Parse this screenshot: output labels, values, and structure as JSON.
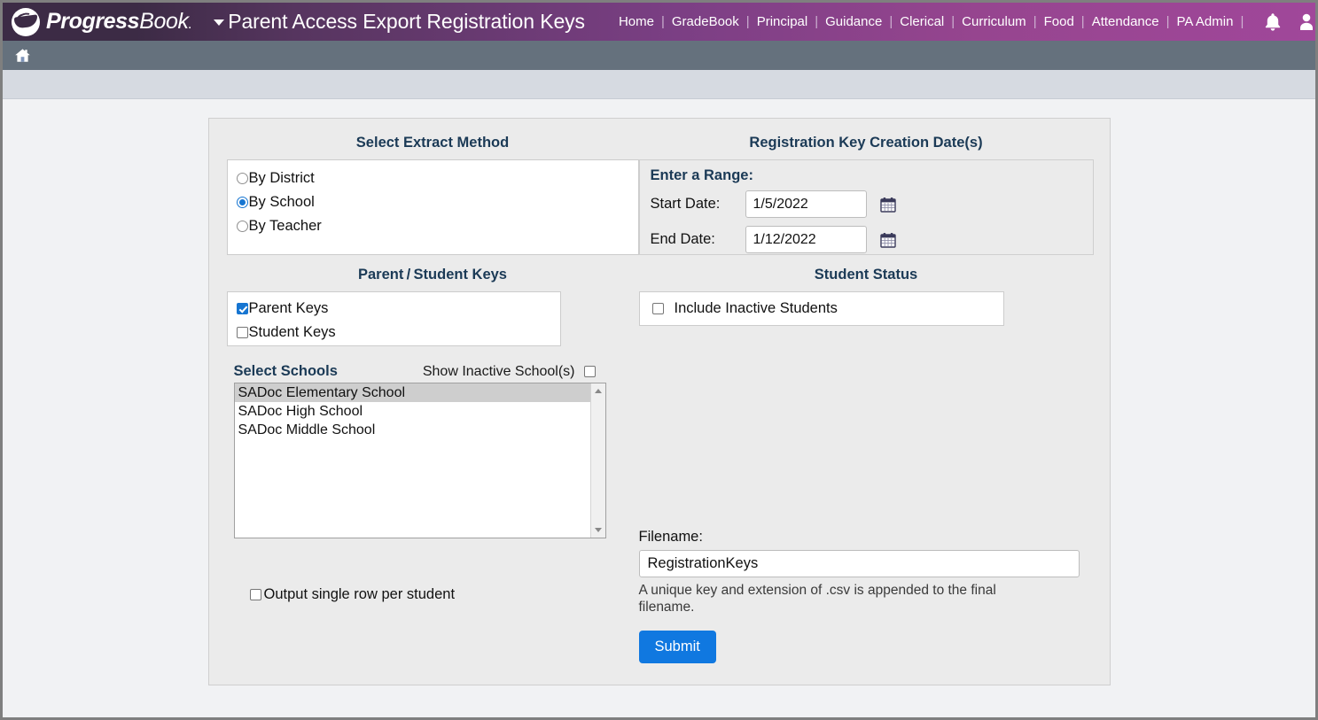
{
  "header": {
    "brand": "ProgressBook",
    "brand_bold": "Progress",
    "brand_light": "Book",
    "brand_tm": ".",
    "page_title": "Parent Access Export Registration Keys",
    "nav_items": [
      "Home",
      "GradeBook",
      "Principal",
      "Guidance",
      "Clerical",
      "Curriculum",
      "Food",
      "Attendance",
      "PA Admin"
    ],
    "nav_separator": "|",
    "icons": [
      "bell-icon",
      "user-icon",
      "help-icon"
    ],
    "accent_purple": "#7b3f84",
    "accent_dark_purple": "#3c2b45"
  },
  "subbar": {
    "home_icon": "home-icon"
  },
  "extract_method": {
    "title": "Select Extract Method",
    "options": [
      {
        "label": "By District",
        "checked": false
      },
      {
        "label": "By School",
        "checked": true
      },
      {
        "label": "By Teacher",
        "checked": false
      }
    ]
  },
  "parent_student_keys": {
    "title": "Parent / Student Keys",
    "options": [
      {
        "label": "Parent Keys",
        "checked": true
      },
      {
        "label": "Student Keys",
        "checked": false
      }
    ]
  },
  "select_schools": {
    "label": "Select Schools",
    "show_inactive_label": "Show Inactive School(s)",
    "show_inactive_checked": false,
    "items": [
      {
        "label": "SADoc Elementary School",
        "selected": true
      },
      {
        "label": "SADoc High School",
        "selected": false
      },
      {
        "label": "SADoc Middle School",
        "selected": false
      }
    ],
    "scroll_up_icon": "scroll-up-arrow-icon",
    "scroll_down_icon": "scroll-down-arrow-icon"
  },
  "output_option": {
    "label": "Output single row per student",
    "checked": false
  },
  "creation_dates": {
    "title": "Registration Key Creation Date(s)",
    "range_label": "Enter a Range:",
    "start_label": "Start Date:",
    "start_value": "1/5/2022",
    "start_placeholder": "",
    "end_label": "End Date:",
    "end_value": "1/12/2022",
    "end_placeholder": "",
    "calendar_icon": "calendar-icon"
  },
  "student_status": {
    "title": "Student Status",
    "include_inactive_label": "Include Inactive Students",
    "include_inactive_checked": false
  },
  "filename": {
    "label": "Filename:",
    "value": "RegistrationKeys",
    "placeholder": "",
    "help_text": "A unique key and extension of .csv is appended to the final filename.",
    "submit_label": "Submit",
    "submit_color": "#1078e0"
  }
}
